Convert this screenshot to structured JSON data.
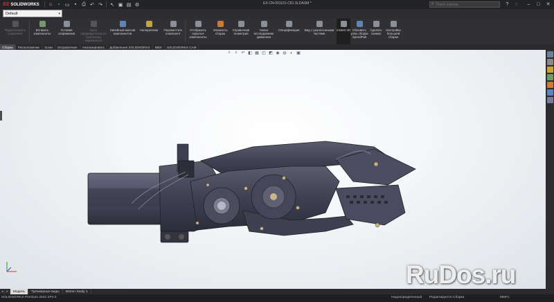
{
  "app": {
    "logo_text": "SOLIDWORKS",
    "document_title": "EX-CN-001101-C81.SLDASM *"
  },
  "search": {
    "placeholder": "Поиск команд"
  },
  "config": {
    "value": "Default"
  },
  "ribbon": [
    {
      "label": "Редактировать компонент",
      "enabled": false,
      "icon": "edit-component-icon"
    },
    {
      "label": "Вставить компоненты",
      "enabled": true,
      "icon": "insert-components-icon"
    },
    {
      "label": "Условия сопряжения",
      "enabled": true,
      "icon": "mate-icon"
    },
    {
      "label": "Окно предварительного просмотра компонента",
      "enabled": false,
      "icon": "preview-window-icon"
    },
    {
      "label": "Линейный массив компонентов",
      "enabled": true,
      "icon": "linear-pattern-icon"
    },
    {
      "label": "Автокрепежи",
      "enabled": true,
      "icon": "smart-fasteners-icon"
    },
    {
      "label": "Переместить компонент",
      "enabled": true,
      "icon": "move-component-icon"
    },
    {
      "label": "Отобразить скрытые компоненты",
      "enabled": true,
      "icon": "show-hidden-icon"
    },
    {
      "label": "Элементы сборки",
      "enabled": true,
      "icon": "assembly-features-icon"
    },
    {
      "label": "Справочная геометрия",
      "enabled": true,
      "icon": "reference-geometry-icon"
    },
    {
      "label": "Новое исследование движения",
      "enabled": true,
      "icon": "motion-study-icon"
    },
    {
      "label": "Спецификация",
      "enabled": true,
      "icon": "bom-icon"
    },
    {
      "label": "Вид с разнесенными частями",
      "enabled": true,
      "icon": "exploded-view-icon"
    },
    {
      "label": "Instant 3D",
      "enabled": true,
      "icon": "instant3d-icon"
    },
    {
      "label": "Обновить узлы сборки SpeedPak",
      "enabled": true,
      "icon": "speedpak-icon"
    },
    {
      "label": "Сделать снимок",
      "enabled": true,
      "icon": "snapshot-icon"
    },
    {
      "label": "Настройки большой сборки",
      "enabled": true,
      "icon": "large-assembly-icon"
    }
  ],
  "tabs": [
    "Сборка",
    "Расположение",
    "Эскиз",
    "Исправление",
    "Анализировать",
    "Добавления SOLIDWORKS",
    "MBD",
    "SOLIDWORKS CAM"
  ],
  "bottom_tabs": [
    "Модель",
    "Трехмерные виды",
    "Motion Study 1"
  ],
  "status": {
    "app_version": "SOLIDWORKS Premium 2022 SP4.0",
    "definition": "Недоопределенный",
    "editing": "Редактируется Сборка",
    "units": "MMГС"
  },
  "watermark": "RuDos.ru"
}
